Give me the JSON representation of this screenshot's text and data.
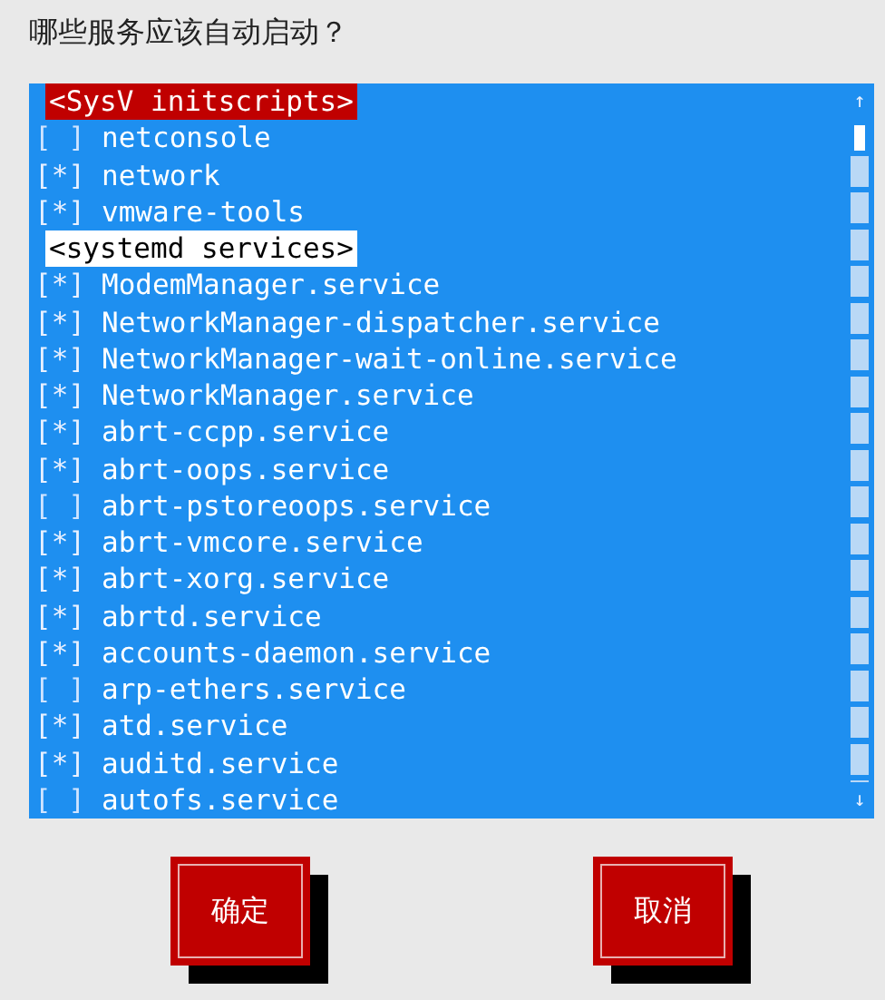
{
  "question": "哪些服务应该自动启动？",
  "list": {
    "scroll_up": "↑",
    "scroll_down": "↓",
    "items": [
      {
        "kind": "header",
        "label": "<SysV initscripts>",
        "selected": true
      },
      {
        "kind": "service",
        "mark": "[ ]",
        "label": "netconsole",
        "checked": false
      },
      {
        "kind": "service",
        "mark": "[*]",
        "label": "network",
        "checked": true
      },
      {
        "kind": "service",
        "mark": "[*]",
        "label": "vmware-tools",
        "checked": true
      },
      {
        "kind": "header",
        "label": "<systemd services>",
        "selected": false
      },
      {
        "kind": "service",
        "mark": "[*]",
        "label": "ModemManager.service",
        "checked": true
      },
      {
        "kind": "service",
        "mark": "[*]",
        "label": "NetworkManager-dispatcher.service",
        "checked": true
      },
      {
        "kind": "service",
        "mark": "[*]",
        "label": "NetworkManager-wait-online.service",
        "checked": true
      },
      {
        "kind": "service",
        "mark": "[*]",
        "label": "NetworkManager.service",
        "checked": true
      },
      {
        "kind": "service",
        "mark": "[*]",
        "label": "abrt-ccpp.service",
        "checked": true
      },
      {
        "kind": "service",
        "mark": "[*]",
        "label": "abrt-oops.service",
        "checked": true
      },
      {
        "kind": "service",
        "mark": "[ ]",
        "label": "abrt-pstoreoops.service",
        "checked": false
      },
      {
        "kind": "service",
        "mark": "[*]",
        "label": "abrt-vmcore.service",
        "checked": true
      },
      {
        "kind": "service",
        "mark": "[*]",
        "label": "abrt-xorg.service",
        "checked": true
      },
      {
        "kind": "service",
        "mark": "[*]",
        "label": "abrtd.service",
        "checked": true
      },
      {
        "kind": "service",
        "mark": "[*]",
        "label": "accounts-daemon.service",
        "checked": true
      },
      {
        "kind": "service",
        "mark": "[ ]",
        "label": "arp-ethers.service",
        "checked": false
      },
      {
        "kind": "service",
        "mark": "[*]",
        "label": "atd.service",
        "checked": true
      },
      {
        "kind": "service",
        "mark": "[*]",
        "label": "auditd.service",
        "checked": true
      },
      {
        "kind": "service",
        "mark": "[ ]",
        "label": "autofs.service",
        "checked": false
      }
    ]
  },
  "buttons": [
    "确定",
    "取消"
  ]
}
